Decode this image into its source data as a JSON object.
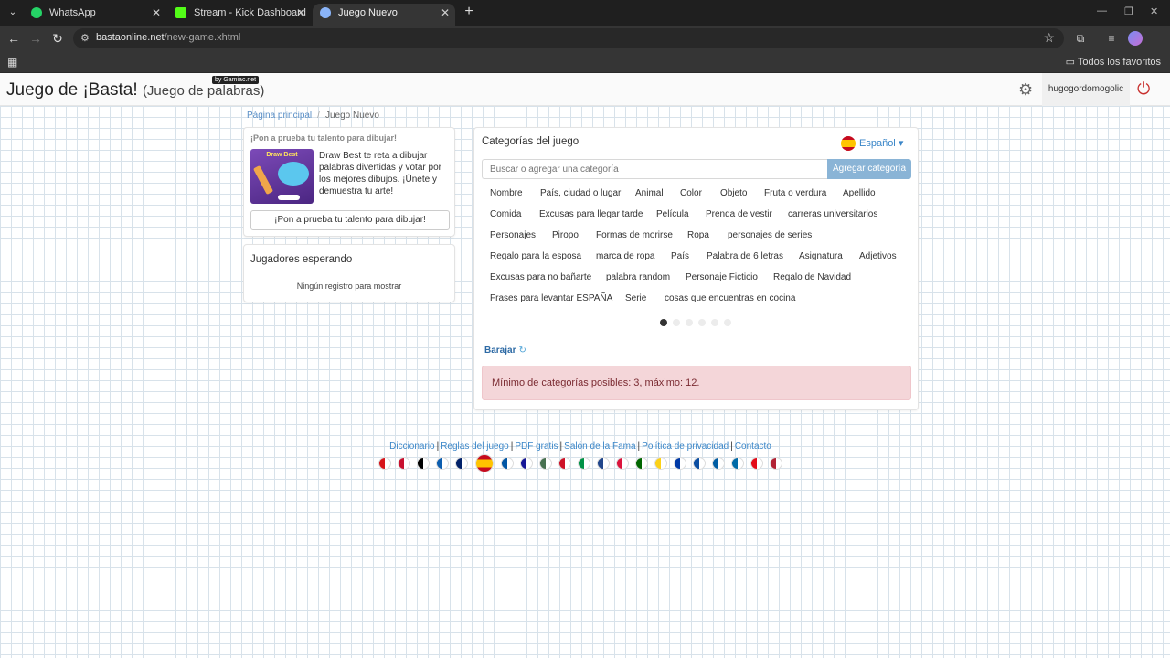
{
  "browser": {
    "tabs": [
      {
        "title": "WhatsApp",
        "icon": "whatsapp-icon",
        "color": "#25d366"
      },
      {
        "title": "Stream - Kick Dashboard",
        "icon": "kick-icon",
        "color": "#53fc18"
      },
      {
        "title": "Juego Nuevo",
        "icon": "globe-icon",
        "color": "#8ab4f8"
      }
    ],
    "url_domain": "bastaonline.net",
    "url_path": "/new-game.xhtml",
    "bookmarks_all": "Todos los favoritos"
  },
  "site": {
    "logo_main": "Juego de ¡Basta!",
    "logo_sub": "(Juego de palabras)",
    "badge": "by Gamiac.net",
    "username": "hugogordomogolic"
  },
  "breadcrumb": {
    "home": "Página principal",
    "sep": "/",
    "current": "Juego Nuevo"
  },
  "promo": {
    "title": "¡Pon a prueba tu talento para dibujar!",
    "image_title": "Draw Best",
    "text": "Draw Best te reta a dibujar palabras divertidas y votar por los mejores dibujos. ¡Únete y demuestra tu arte!",
    "button": "¡Pon a prueba tu talento para dibujar!"
  },
  "waiting": {
    "title": "Jugadores esperando",
    "empty": "Ningún registro para mostrar"
  },
  "categories": {
    "title": "Categorías del juego",
    "language": "Español",
    "search_placeholder": "Buscar o agregar una categoría",
    "add_button": "Agregar categoría",
    "rows": [
      [
        "Nombre",
        "País, ciudad o lugar",
        "Animal",
        "Color",
        "Objeto",
        "Fruta o verdura",
        "Apellido"
      ],
      [
        "Comida",
        "Excusas para llegar tarde",
        "Película",
        "Prenda de vestir",
        "carreras universitarios"
      ],
      [
        "Personajes",
        "Piropo",
        "Formas de morirse",
        "Ropa",
        "personajes de series"
      ],
      [
        "Regalo para la esposa",
        "marca de ropa",
        "País",
        "Palabra de 6 letras",
        "Asignatura",
        "Adjetivos"
      ],
      [
        "Excusas para no bañarte",
        "palabra random",
        "Personaje Ficticio",
        "Regalo de Navidad"
      ],
      [
        "Frases para levantar ESPAÑA",
        "Serie",
        "cosas que encuentras en cocina"
      ]
    ],
    "pages": 6,
    "current_page": 1,
    "shuffle": "Barajar",
    "alert": "Mínimo de categorías posibles: 3, máximo: 12."
  },
  "footer": {
    "links": [
      "Diccionario",
      "Reglas del juego",
      "PDF gratis",
      "Salón de la Fama",
      "Política de privacidad",
      "Contacto"
    ]
  },
  "flags": [
    {
      "name": "czech-flag-icon",
      "color": "#d7141a"
    },
    {
      "name": "denmark-flag-icon",
      "color": "#c8102e"
    },
    {
      "name": "germany-flag-icon",
      "color": "#000000"
    },
    {
      "name": "greece-flag-icon",
      "color": "#0d5eaf"
    },
    {
      "name": "uk-flag-icon",
      "color": "#012169"
    },
    {
      "name": "spain-flag-icon",
      "color": "#c60b1e"
    },
    {
      "name": "france-flag-icon",
      "color": "#0055a4"
    },
    {
      "name": "croatia-flag-icon",
      "color": "#171796"
    },
    {
      "name": "hungary-flag-icon",
      "color": "#477050"
    },
    {
      "name": "indonesia-flag-icon",
      "color": "#ce1126"
    },
    {
      "name": "italy-flag-icon",
      "color": "#009246"
    },
    {
      "name": "netherlands-flag-icon",
      "color": "#21468b"
    },
    {
      "name": "poland-flag-icon",
      "color": "#dc143c"
    },
    {
      "name": "portugal-flag-icon",
      "color": "#006600"
    },
    {
      "name": "romania-flag-icon",
      "color": "#fcd116"
    },
    {
      "name": "russia-flag-icon",
      "color": "#0039a6"
    },
    {
      "name": "slovakia-flag-icon",
      "color": "#0b4ea2"
    },
    {
      "name": "slovenia-flag-icon",
      "color": "#005da4"
    },
    {
      "name": "sweden-flag-icon",
      "color": "#006aa7"
    },
    {
      "name": "turkey-flag-icon",
      "color": "#e30a17"
    },
    {
      "name": "usa-flag-icon",
      "color": "#b22234"
    }
  ]
}
